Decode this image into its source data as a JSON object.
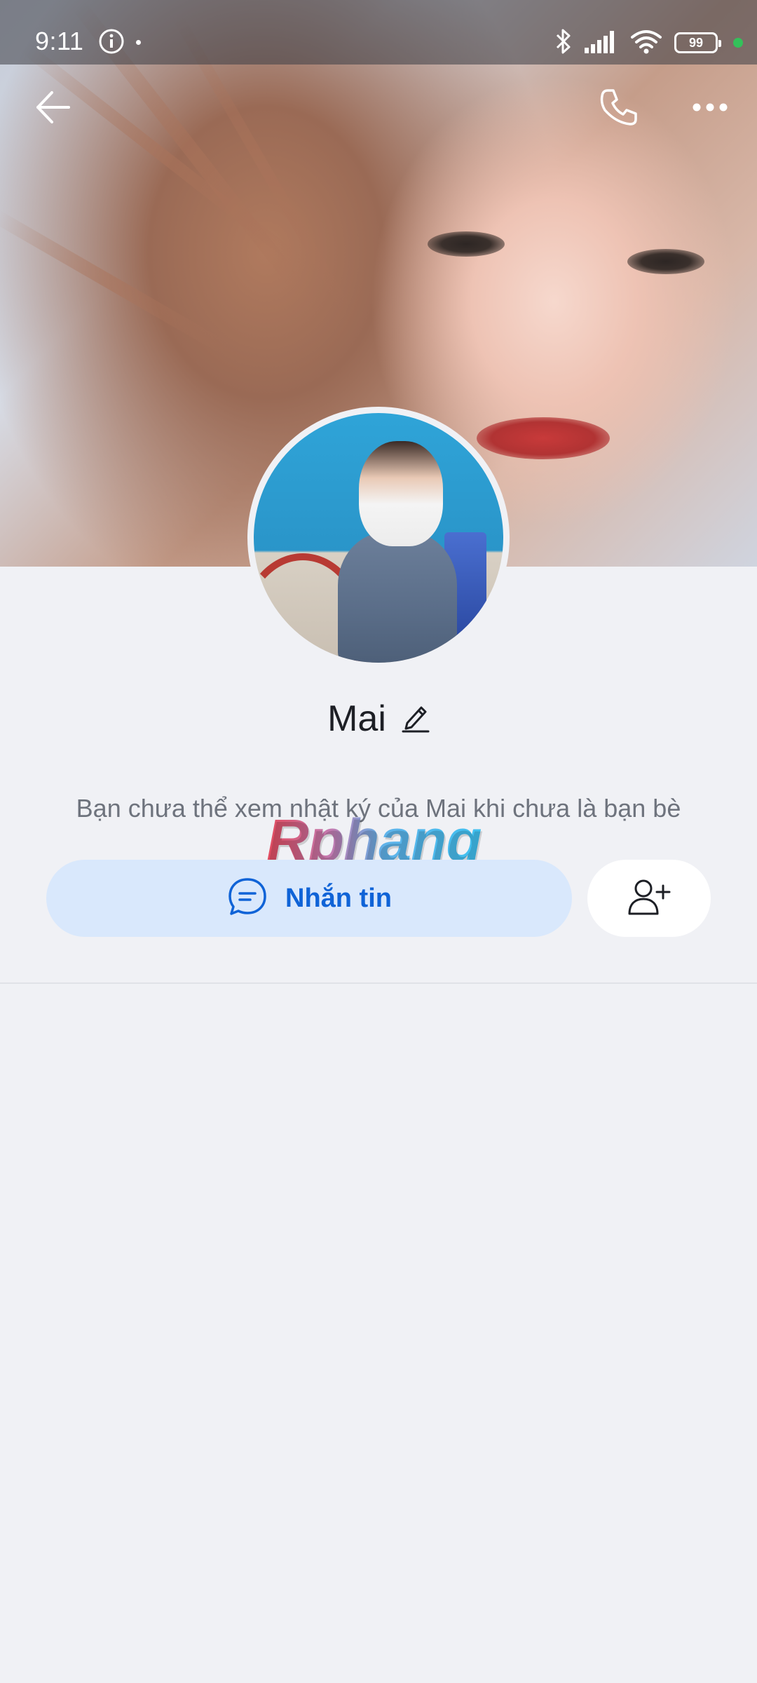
{
  "status_bar": {
    "time": "9:11",
    "battery": "99"
  },
  "profile": {
    "name": "Mai",
    "notice": "Bạn chưa thể xem nhật ký của Mai khi chưa là bạn bè"
  },
  "actions": {
    "message_label": "Nhắn tin"
  },
  "watermark": "Rphang",
  "icons": {
    "back": "arrow-left-icon",
    "call": "phone-icon",
    "more": "more-dots-icon",
    "edit": "pencil-icon",
    "chat": "chat-bubble-icon",
    "add_friend": "add-user-icon"
  },
  "colors": {
    "accent": "#0f63d7",
    "accent_bg": "#d9e8fc",
    "page_bg": "#f0f1f5",
    "text_primary": "#1d1f25",
    "text_secondary": "#6e737d",
    "status_green": "#33c15a"
  }
}
